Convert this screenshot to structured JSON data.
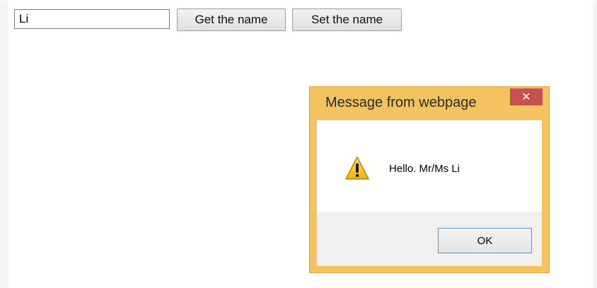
{
  "form": {
    "name_value": "Li",
    "get_label": "Get the name",
    "set_label": "Set the name"
  },
  "dialog": {
    "title": "Message from webpage",
    "close_glyph": "✕",
    "message": "Hello. Mr/Ms Li",
    "ok_label": "OK",
    "icon": "warning-icon"
  },
  "colors": {
    "dialog_frame": "#f2c35e",
    "close_button": "#c75050",
    "ok_border": "#4e9bd9"
  }
}
